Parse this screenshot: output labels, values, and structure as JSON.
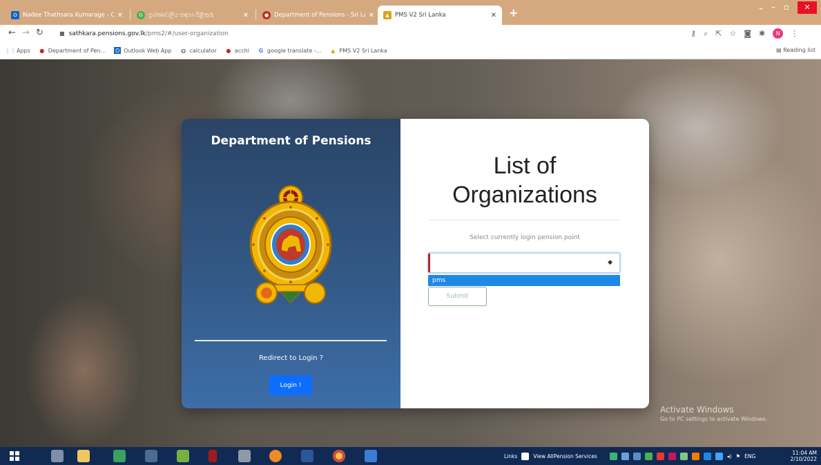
{
  "browser": {
    "tabs": [
      {
        "title": "Nadee Thathsara Kumarage - Ou",
        "favicon": "outlook-icon",
        "color": "#1565c0"
      },
      {
        "title": "ප්‍රශ්ණාවලිය සඳහා පිළිතුරු",
        "favicon": "google-icon",
        "color": "#4caf50"
      },
      {
        "title": "Department of Pensions - Sri La",
        "favicon": "pensions-icon",
        "color": "#c62828"
      },
      {
        "title": "PMS V2 Sri Lanka",
        "favicon": "pms-icon",
        "color": "#e0a21a",
        "active": true
      }
    ],
    "url_host": "sathkara.pensions.gov.lk",
    "url_path": "/pms2/#/user-organization",
    "profile_initial": "N",
    "bookmarks": [
      {
        "label": "Apps",
        "icon": "apps-grid-icon"
      },
      {
        "label": "Department of Pen...",
        "icon": "pensions-icon"
      },
      {
        "label": "Outlook Web App",
        "icon": "outlook-icon"
      },
      {
        "label": "calculator",
        "icon": "globe-icon"
      },
      {
        "label": "acchi",
        "icon": "pensions-icon"
      },
      {
        "label": "google translate -...",
        "icon": "google-icon"
      },
      {
        "label": "PMS V2 Sri Lanka",
        "icon": "pms-icon"
      }
    ],
    "reading_list": "Reading list"
  },
  "card": {
    "dept_title": "Department of Pensions",
    "redirect_text": "Redirect to Login ?",
    "login_label": "Login !",
    "list_title_line1": "List of",
    "list_title_line2": "Organizations",
    "select_label": "Select currently login pension point",
    "select_value": "",
    "dropdown_option": "pms",
    "submit_label": "Submit"
  },
  "watermark": {
    "line1": "Activate Windows",
    "line2": "Go to PC settings to activate Windows."
  },
  "taskbar": {
    "links_label": "Links",
    "view_services": "View AllPension Services",
    "lang": "ENG",
    "time": "11:04 AM",
    "date": "2/10/2022"
  },
  "colors": {
    "tabstrip": "#d5a97f",
    "card_left_top": "#2a4466",
    "card_left_bottom": "#3d6ea8",
    "login_button": "#0d6efd",
    "dropdown_highlight": "#1e88e5",
    "select_accent": "#b2242a",
    "taskbar": "#102a54"
  }
}
